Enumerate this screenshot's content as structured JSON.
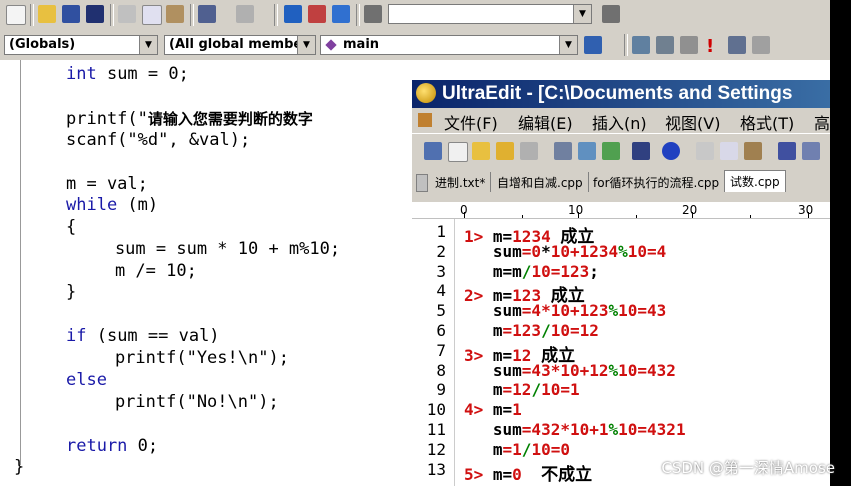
{
  "toolbar": {
    "search_value": "",
    "globals_combo": "(Globals)",
    "members_combo": "(All global member",
    "function_combo": "main"
  },
  "code_lines": [
    {
      "kw": "int",
      "text": " sum = 0;"
    },
    {
      "text": "printf(\"",
      "zh": "请输入您需要判断的数字",
      "after": ""
    },
    {
      "text": "scanf(\"%d\", &val);"
    },
    {
      "text": "m = val;"
    },
    {
      "kw": "while",
      "text": " (m)"
    },
    {
      "text": "{"
    },
    {
      "text": "    sum = sum * 10 + m%10;"
    },
    {
      "text": "    m /= 10;"
    },
    {
      "text": "}"
    },
    {
      "kw": "if",
      "text": " (sum == val)"
    },
    {
      "text": "    printf(\"Yes!\\n\");"
    },
    {
      "kw": "else",
      "text": ""
    },
    {
      "text": "    printf(\"No!\\n\");"
    },
    {
      "kw": "return",
      "text": " 0;"
    },
    {
      "text": "}"
    }
  ],
  "ultraedit": {
    "title": "UltraEdit - [C:\\Documents and Settings",
    "menu": [
      "文件(F)",
      "编辑(E)",
      "插入(n)",
      "视图(V)",
      "格式(T)",
      "高"
    ],
    "tabs": [
      "进制.txt*",
      "自增和自减.cpp",
      "for循环执行的流程.cpp",
      "试数.cpp"
    ],
    "active_tab_index": 3,
    "ruler": [
      "0",
      "10",
      "20",
      "30"
    ],
    "lines": [
      {
        "n": "1",
        "parts": [
          {
            "c": "red",
            "t": "1> "
          },
          {
            "c": "blk",
            "t": "m="
          },
          {
            "c": "red",
            "t": "1234 "
          },
          {
            "c": "blk",
            "t": "成立",
            "zh": true
          }
        ]
      },
      {
        "n": "2",
        "parts": [
          {
            "c": "blk",
            "t": "   sum"
          },
          {
            "c": "red",
            "t": "=0"
          },
          {
            "c": "blk",
            "t": "*"
          },
          {
            "c": "red",
            "t": "10+1234"
          },
          {
            "c": "grn",
            "t": "%"
          },
          {
            "c": "red",
            "t": "10=4"
          }
        ]
      },
      {
        "n": "3",
        "parts": [
          {
            "c": "blk",
            "t": "   m=m"
          },
          {
            "c": "grn",
            "t": "/"
          },
          {
            "c": "red",
            "t": "10=123"
          },
          {
            "c": "blk",
            "t": ";"
          }
        ]
      },
      {
        "n": "4",
        "parts": [
          {
            "c": "red",
            "t": "2> "
          },
          {
            "c": "blk",
            "t": "m="
          },
          {
            "c": "red",
            "t": "123 "
          },
          {
            "c": "blk",
            "t": "成立",
            "zh": true
          }
        ]
      },
      {
        "n": "5",
        "parts": [
          {
            "c": "blk",
            "t": "   sum"
          },
          {
            "c": "red",
            "t": "=4*10+123"
          },
          {
            "c": "grn",
            "t": "%"
          },
          {
            "c": "red",
            "t": "10=43"
          }
        ]
      },
      {
        "n": "6",
        "parts": [
          {
            "c": "blk",
            "t": "   m"
          },
          {
            "c": "red",
            "t": "=123"
          },
          {
            "c": "grn",
            "t": "/"
          },
          {
            "c": "red",
            "t": "10=12"
          }
        ]
      },
      {
        "n": "7",
        "parts": [
          {
            "c": "red",
            "t": "3> "
          },
          {
            "c": "blk",
            "t": "m="
          },
          {
            "c": "red",
            "t": "12 "
          },
          {
            "c": "blk",
            "t": "成立",
            "zh": true
          }
        ]
      },
      {
        "n": "8",
        "parts": [
          {
            "c": "blk",
            "t": "   sum"
          },
          {
            "c": "red",
            "t": "=43*10+12"
          },
          {
            "c": "grn",
            "t": "%"
          },
          {
            "c": "red",
            "t": "10=432"
          }
        ]
      },
      {
        "n": "9",
        "parts": [
          {
            "c": "blk",
            "t": "   m"
          },
          {
            "c": "red",
            "t": "=12"
          },
          {
            "c": "grn",
            "t": "/"
          },
          {
            "c": "red",
            "t": "10=1"
          }
        ]
      },
      {
        "n": "10",
        "parts": [
          {
            "c": "red",
            "t": "4> "
          },
          {
            "c": "blk",
            "t": "m="
          },
          {
            "c": "red",
            "t": "1"
          }
        ]
      },
      {
        "n": "11",
        "parts": [
          {
            "c": "blk",
            "t": "   sum"
          },
          {
            "c": "red",
            "t": "=432*10+1"
          },
          {
            "c": "grn",
            "t": "%"
          },
          {
            "c": "red",
            "t": "10=4321"
          }
        ]
      },
      {
        "n": "12",
        "parts": [
          {
            "c": "blk",
            "t": "   m"
          },
          {
            "c": "red",
            "t": "=1"
          },
          {
            "c": "grn",
            "t": "/"
          },
          {
            "c": "red",
            "t": "10=0"
          }
        ]
      },
      {
        "n": "13",
        "parts": [
          {
            "c": "red",
            "t": "5> "
          },
          {
            "c": "blk",
            "t": "m="
          },
          {
            "c": "red",
            "t": "0  "
          },
          {
            "c": "blk",
            "t": "不成立",
            "zh": true
          }
        ]
      }
    ]
  },
  "watermark": "CSDN @第一深情Amose"
}
